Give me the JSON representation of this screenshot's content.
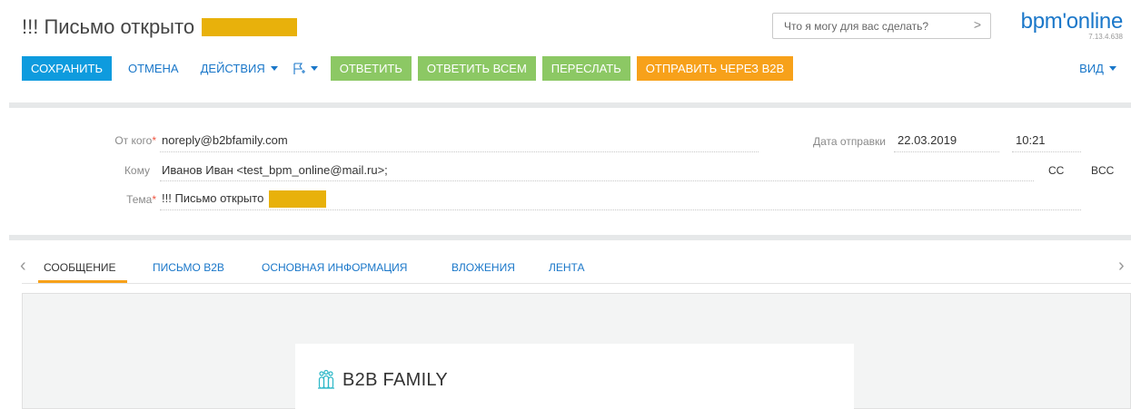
{
  "header": {
    "title": "!!! Письмо открыто",
    "search_placeholder": "Что я могу для вас сделать?",
    "search_chevron": ">",
    "logo_text": "bpm'online",
    "version": "7.13.4.638"
  },
  "toolbar": {
    "save_label": "СОХРАНИТЬ",
    "cancel_label": "ОТМЕНА",
    "actions_label": "ДЕЙСТВИЯ",
    "reply_label": "ОТВЕТИТЬ",
    "reply_all_label": "ОТВЕТИТЬ ВСЕМ",
    "forward_label": "ПЕРЕСЛАТЬ",
    "send_b2b_label": "ОТПРАВИТЬ ЧЕРЕЗ B2B",
    "view_label": "ВИД",
    "colors": {
      "save": "#0e9bde",
      "green": "#8cc864",
      "orange": "#f7a11a"
    }
  },
  "fields": {
    "from_label": "От кого",
    "from_value": "noreply@b2bfamily.com",
    "to_label": "Кому",
    "to_value": "Иванов Иван <test_bpm_online@mail.ru>;",
    "subject_label": "Тема",
    "subject_value": "!!! Письмо открыто",
    "required_mark": "*",
    "sent_date_label": "Дата отправки",
    "sent_date_value": "22.03.2019",
    "sent_time_value": "10:21",
    "cc_label": "CC",
    "bcc_label": "BCC"
  },
  "tabs": {
    "items": [
      {
        "label": "СООБЩЕНИЕ",
        "active": true
      },
      {
        "label": "ПИСЬМО B2B",
        "active": false
      },
      {
        "label": "ОСНОВНАЯ ИНФОРМАЦИЯ",
        "active": false
      },
      {
        "label": "ВЛОЖЕНИЯ",
        "active": false
      },
      {
        "label": "ЛЕНТА",
        "active": false
      }
    ],
    "prev_arrow": "‹",
    "next_arrow": "›"
  },
  "message": {
    "brand_name": "B2B FAMILY",
    "brand_icon": "family-icon"
  }
}
